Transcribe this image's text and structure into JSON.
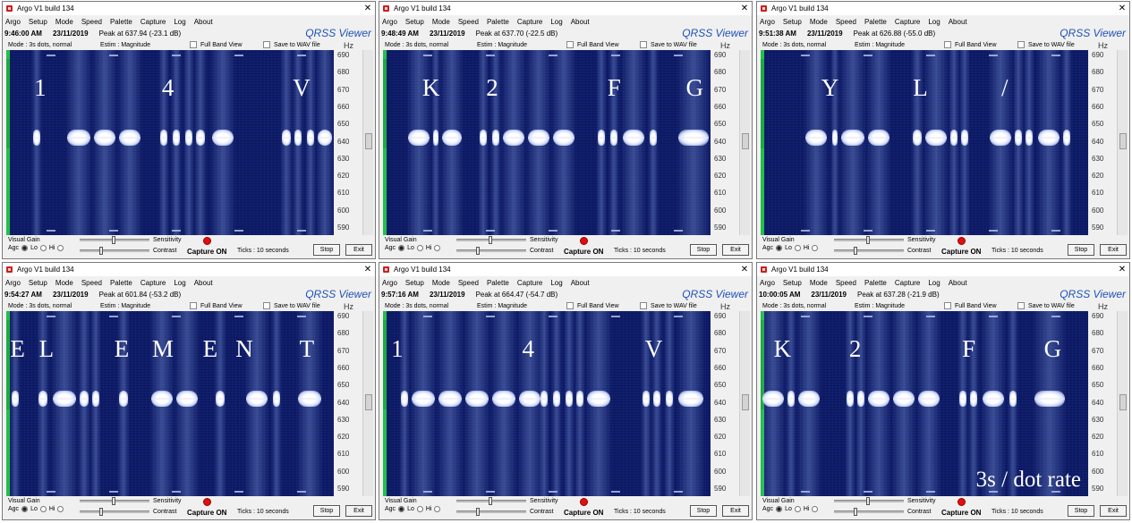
{
  "overlay_caption": "3s / dot rate",
  "shared": {
    "title": "Argo V1 build 134",
    "close_glyph": "✕",
    "menu": [
      "Argo",
      "Setup",
      "Mode",
      "Speed",
      "Palette",
      "Capture",
      "Log",
      "About"
    ],
    "viewer_label": "QRSS Viewer",
    "mode": "Mode : 3s dots, normal",
    "estim": "Estim : Magnitude",
    "full_band": "Full Band View",
    "save_wav": "Save to WAV file",
    "hz_unit": "Hz",
    "hz_ticks": [
      "690",
      "680",
      "670",
      "660",
      "650",
      "640",
      "630",
      "620",
      "610",
      "600",
      "590"
    ],
    "visual_gain": "Visual Gain",
    "agc": "Agc",
    "lo": "Lo",
    "hi": "Hi",
    "sensitivity": "Sensitivity",
    "contrast": "Contrast",
    "capture": "Capture ON",
    "ticks": "Ticks : 10 seconds",
    "stop": "Stop",
    "exit": "Exit"
  },
  "windows": [
    {
      "time": "9:46:00 AM",
      "date": "23/11/2019",
      "peak": "Peak at 637.94 (-23.1 dB)",
      "letters": [
        {
          "t": "1",
          "x": 0.085
        },
        {
          "t": "4",
          "x": 0.475
        },
        {
          "t": "V",
          "x": 0.875
        }
      ],
      "marks": [
        [
          30,
          38
        ],
        [
          68,
          94
        ],
        [
          98,
          122
        ],
        [
          126,
          150
        ],
        [
          172,
          180
        ],
        [
          186,
          194
        ],
        [
          200,
          208
        ],
        [
          212,
          222
        ],
        [
          230,
          254
        ],
        [
          308,
          318
        ],
        [
          322,
          330
        ],
        [
          336,
          344
        ],
        [
          348,
          364
        ]
      ]
    },
    {
      "time": "9:48:49 AM",
      "date": "23/11/2019",
      "peak": "Peak at 637.70 (-22.5 dB)",
      "letters": [
        {
          "t": "K",
          "x": 0.12
        },
        {
          "t": "2",
          "x": 0.315
        },
        {
          "t": "F",
          "x": 0.685
        },
        {
          "t": "G",
          "x": 0.925
        }
      ],
      "marks": [
        [
          28,
          52
        ],
        [
          56,
          62
        ],
        [
          66,
          88
        ],
        [
          108,
          116
        ],
        [
          122,
          130
        ],
        [
          134,
          158
        ],
        [
          162,
          186
        ],
        [
          190,
          214
        ],
        [
          240,
          248
        ],
        [
          254,
          262
        ],
        [
          268,
          292
        ],
        [
          298,
          306
        ],
        [
          330,
          364
        ]
      ]
    },
    {
      "time": "9:51:38 AM",
      "date": "23/11/2019",
      "peak": "Peak at 626.88 (-55.0 dB)",
      "letters": [
        {
          "t": "Y",
          "x": 0.185
        },
        {
          "t": "L",
          "x": 0.465
        },
        {
          "t": "/",
          "x": 0.735
        }
      ],
      "marks": [
        [
          50,
          74
        ],
        [
          80,
          86
        ],
        [
          90,
          116
        ],
        [
          120,
          144
        ],
        [
          170,
          180
        ],
        [
          184,
          208
        ],
        [
          212,
          220
        ],
        [
          224,
          232
        ],
        [
          256,
          280
        ],
        [
          284,
          292
        ],
        [
          296,
          304
        ],
        [
          310,
          334
        ],
        [
          338,
          346
        ]
      ]
    },
    {
      "time": "9:54:27 AM",
      "date": "23/11/2019",
      "peak": "Peak at 601.84 (-53.2 dB)",
      "letters": [
        {
          "t": "E",
          "x": 0.012
        },
        {
          "t": "L",
          "x": 0.1
        },
        {
          "t": "E",
          "x": 0.33
        },
        {
          "t": "M",
          "x": 0.445
        },
        {
          "t": "E",
          "x": 0.6
        },
        {
          "t": "N",
          "x": 0.7
        },
        {
          "t": "T",
          "x": 0.895
        }
      ],
      "marks": [
        [
          6,
          14
        ],
        [
          36,
          46
        ],
        [
          52,
          78
        ],
        [
          82,
          92
        ],
        [
          96,
          104
        ],
        [
          126,
          136
        ],
        [
          162,
          186
        ],
        [
          190,
          214
        ],
        [
          234,
          244
        ],
        [
          268,
          292
        ],
        [
          298,
          306
        ],
        [
          326,
          352
        ]
      ]
    },
    {
      "time": "9:57:16 AM",
      "date": "23/11/2019",
      "peak": "Peak at 664.47 (-54.7 dB)",
      "letters": [
        {
          "t": "1",
          "x": 0.025
        },
        {
          "t": "4",
          "x": 0.425
        },
        {
          "t": "V",
          "x": 0.8
        }
      ],
      "marks": [
        [
          20,
          28
        ],
        [
          32,
          58
        ],
        [
          62,
          88
        ],
        [
          92,
          118
        ],
        [
          122,
          148
        ],
        [
          152,
          176
        ],
        [
          176,
          184
        ],
        [
          190,
          198
        ],
        [
          204,
          212
        ],
        [
          216,
          224
        ],
        [
          228,
          254
        ],
        [
          290,
          298
        ],
        [
          302,
          310
        ],
        [
          316,
          324
        ],
        [
          330,
          358
        ]
      ]
    },
    {
      "time": "10:00:05 AM",
      "date": "23/11/2019",
      "peak": "Peak at 637.28 (-21.9 dB)",
      "letters": [
        {
          "t": "K",
          "x": 0.04
        },
        {
          "t": "2",
          "x": 0.27
        },
        {
          "t": "F",
          "x": 0.615
        },
        {
          "t": "G",
          "x": 0.865
        }
      ],
      "marks": [
        [
          2,
          26
        ],
        [
          30,
          38
        ],
        [
          42,
          66
        ],
        [
          96,
          104
        ],
        [
          108,
          116
        ],
        [
          120,
          144
        ],
        [
          148,
          172
        ],
        [
          176,
          200
        ],
        [
          222,
          230
        ],
        [
          234,
          242
        ],
        [
          248,
          272
        ],
        [
          278,
          286
        ],
        [
          306,
          340
        ]
      ]
    }
  ]
}
